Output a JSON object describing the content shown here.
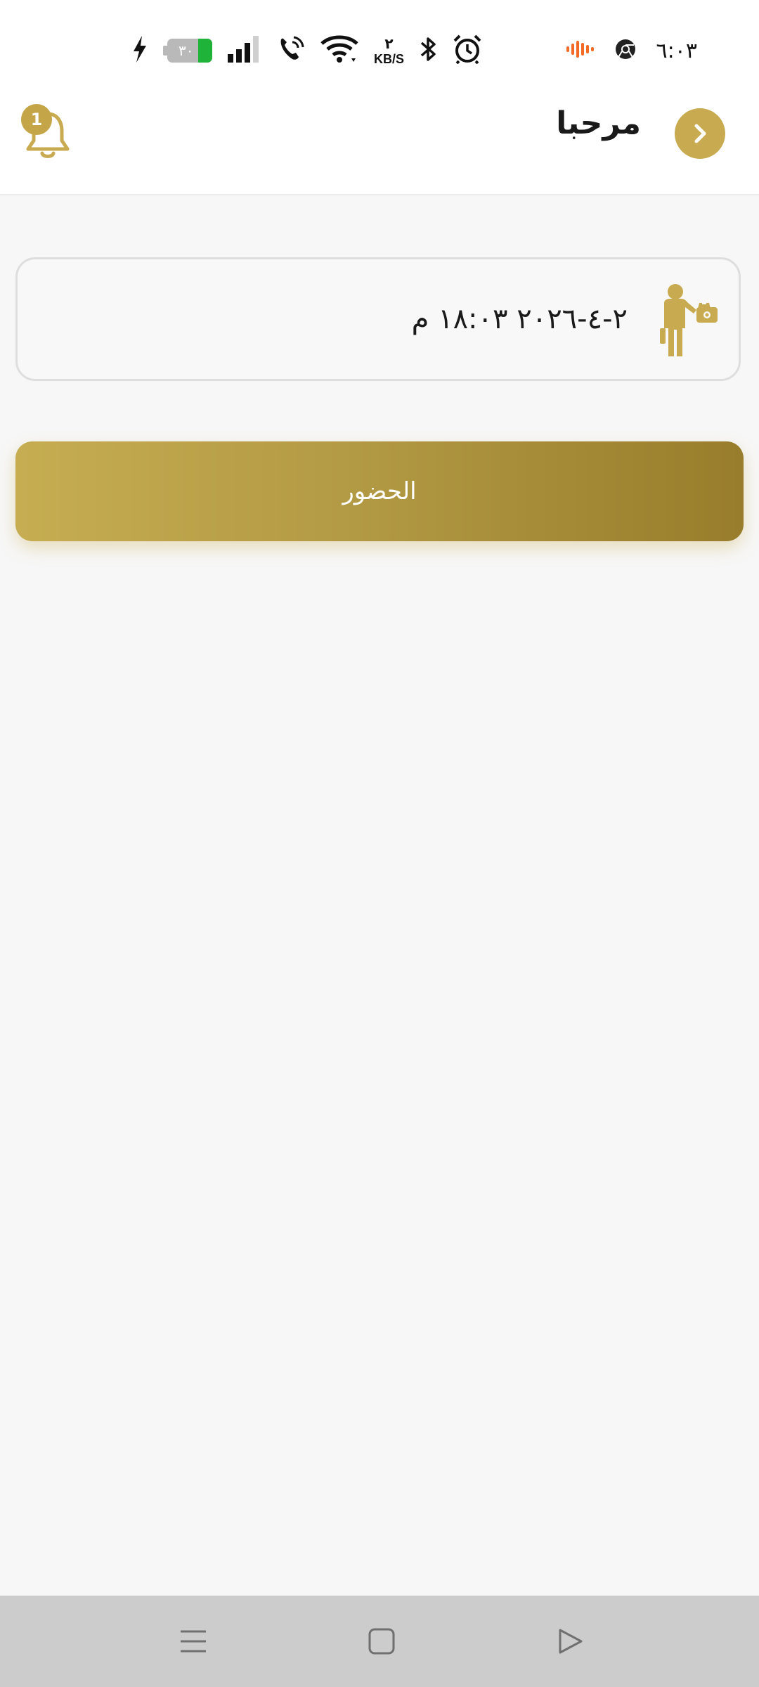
{
  "status_bar": {
    "time": "٦:٠٣",
    "battery_level": "٣٠",
    "net_speed_value": "٢",
    "net_speed_unit": "KB/S",
    "icons": [
      "charging-icon",
      "battery-icon",
      "signal-icon",
      "wifi-calling-icon",
      "wifi-icon",
      "bluetooth-icon",
      "alarm-icon",
      "sound-wave-icon",
      "chrome-icon"
    ],
    "colors": {
      "battery_fill": "#20b33a",
      "sound_wave": "#f26a25"
    }
  },
  "header": {
    "title": "مرحبا",
    "back_icon": "chevron-right-icon",
    "notification_icon": "bell-icon",
    "notification_count": "1"
  },
  "date_card": {
    "datetime": "٢-٤-٢٠٢٦ ١٨:٠٣ م",
    "icon": "worker-with-bag-icon"
  },
  "attendance": {
    "label": "الحضور"
  },
  "navigation": {
    "icons": [
      "menu-icon",
      "home-square-icon",
      "back-triangle-icon"
    ]
  },
  "theme": {
    "accent": "#c8aa50",
    "accent_dark": "#987d2c",
    "background": "#f7f7f7"
  }
}
